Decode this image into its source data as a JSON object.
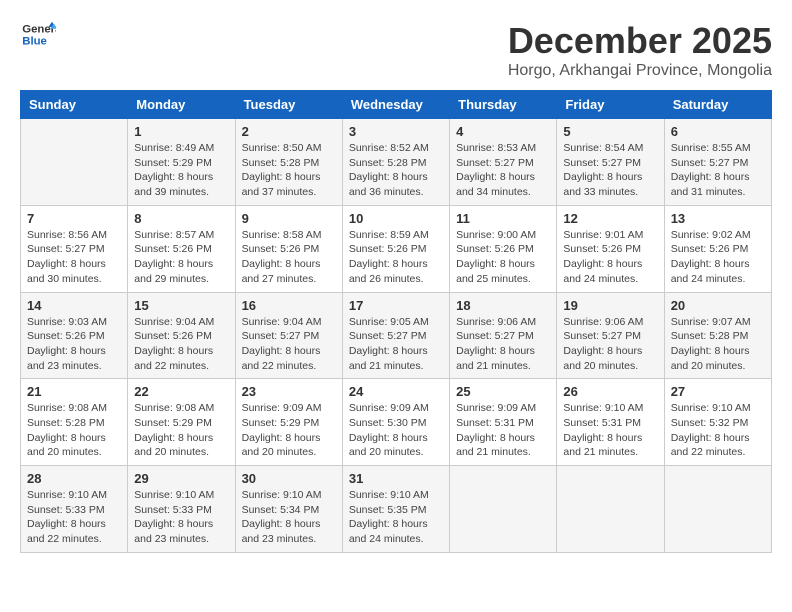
{
  "logo": {
    "line1": "General",
    "line2": "Blue"
  },
  "title": "December 2025",
  "subtitle": "Horgo, Arkhangai Province, Mongolia",
  "days_of_week": [
    "Sunday",
    "Monday",
    "Tuesday",
    "Wednesday",
    "Thursday",
    "Friday",
    "Saturday"
  ],
  "weeks": [
    [
      {
        "day": "",
        "sunrise": "",
        "sunset": "",
        "daylight": ""
      },
      {
        "day": "1",
        "sunrise": "Sunrise: 8:49 AM",
        "sunset": "Sunset: 5:29 PM",
        "daylight": "Daylight: 8 hours and 39 minutes."
      },
      {
        "day": "2",
        "sunrise": "Sunrise: 8:50 AM",
        "sunset": "Sunset: 5:28 PM",
        "daylight": "Daylight: 8 hours and 37 minutes."
      },
      {
        "day": "3",
        "sunrise": "Sunrise: 8:52 AM",
        "sunset": "Sunset: 5:28 PM",
        "daylight": "Daylight: 8 hours and 36 minutes."
      },
      {
        "day": "4",
        "sunrise": "Sunrise: 8:53 AM",
        "sunset": "Sunset: 5:27 PM",
        "daylight": "Daylight: 8 hours and 34 minutes."
      },
      {
        "day": "5",
        "sunrise": "Sunrise: 8:54 AM",
        "sunset": "Sunset: 5:27 PM",
        "daylight": "Daylight: 8 hours and 33 minutes."
      },
      {
        "day": "6",
        "sunrise": "Sunrise: 8:55 AM",
        "sunset": "Sunset: 5:27 PM",
        "daylight": "Daylight: 8 hours and 31 minutes."
      }
    ],
    [
      {
        "day": "7",
        "sunrise": "Sunrise: 8:56 AM",
        "sunset": "Sunset: 5:27 PM",
        "daylight": "Daylight: 8 hours and 30 minutes."
      },
      {
        "day": "8",
        "sunrise": "Sunrise: 8:57 AM",
        "sunset": "Sunset: 5:26 PM",
        "daylight": "Daylight: 8 hours and 29 minutes."
      },
      {
        "day": "9",
        "sunrise": "Sunrise: 8:58 AM",
        "sunset": "Sunset: 5:26 PM",
        "daylight": "Daylight: 8 hours and 27 minutes."
      },
      {
        "day": "10",
        "sunrise": "Sunrise: 8:59 AM",
        "sunset": "Sunset: 5:26 PM",
        "daylight": "Daylight: 8 hours and 26 minutes."
      },
      {
        "day": "11",
        "sunrise": "Sunrise: 9:00 AM",
        "sunset": "Sunset: 5:26 PM",
        "daylight": "Daylight: 8 hours and 25 minutes."
      },
      {
        "day": "12",
        "sunrise": "Sunrise: 9:01 AM",
        "sunset": "Sunset: 5:26 PM",
        "daylight": "Daylight: 8 hours and 24 minutes."
      },
      {
        "day": "13",
        "sunrise": "Sunrise: 9:02 AM",
        "sunset": "Sunset: 5:26 PM",
        "daylight": "Daylight: 8 hours and 24 minutes."
      }
    ],
    [
      {
        "day": "14",
        "sunrise": "Sunrise: 9:03 AM",
        "sunset": "Sunset: 5:26 PM",
        "daylight": "Daylight: 8 hours and 23 minutes."
      },
      {
        "day": "15",
        "sunrise": "Sunrise: 9:04 AM",
        "sunset": "Sunset: 5:26 PM",
        "daylight": "Daylight: 8 hours and 22 minutes."
      },
      {
        "day": "16",
        "sunrise": "Sunrise: 9:04 AM",
        "sunset": "Sunset: 5:27 PM",
        "daylight": "Daylight: 8 hours and 22 minutes."
      },
      {
        "day": "17",
        "sunrise": "Sunrise: 9:05 AM",
        "sunset": "Sunset: 5:27 PM",
        "daylight": "Daylight: 8 hours and 21 minutes."
      },
      {
        "day": "18",
        "sunrise": "Sunrise: 9:06 AM",
        "sunset": "Sunset: 5:27 PM",
        "daylight": "Daylight: 8 hours and 21 minutes."
      },
      {
        "day": "19",
        "sunrise": "Sunrise: 9:06 AM",
        "sunset": "Sunset: 5:27 PM",
        "daylight": "Daylight: 8 hours and 20 minutes."
      },
      {
        "day": "20",
        "sunrise": "Sunrise: 9:07 AM",
        "sunset": "Sunset: 5:28 PM",
        "daylight": "Daylight: 8 hours and 20 minutes."
      }
    ],
    [
      {
        "day": "21",
        "sunrise": "Sunrise: 9:08 AM",
        "sunset": "Sunset: 5:28 PM",
        "daylight": "Daylight: 8 hours and 20 minutes."
      },
      {
        "day": "22",
        "sunrise": "Sunrise: 9:08 AM",
        "sunset": "Sunset: 5:29 PM",
        "daylight": "Daylight: 8 hours and 20 minutes."
      },
      {
        "day": "23",
        "sunrise": "Sunrise: 9:09 AM",
        "sunset": "Sunset: 5:29 PM",
        "daylight": "Daylight: 8 hours and 20 minutes."
      },
      {
        "day": "24",
        "sunrise": "Sunrise: 9:09 AM",
        "sunset": "Sunset: 5:30 PM",
        "daylight": "Daylight: 8 hours and 20 minutes."
      },
      {
        "day": "25",
        "sunrise": "Sunrise: 9:09 AM",
        "sunset": "Sunset: 5:31 PM",
        "daylight": "Daylight: 8 hours and 21 minutes."
      },
      {
        "day": "26",
        "sunrise": "Sunrise: 9:10 AM",
        "sunset": "Sunset: 5:31 PM",
        "daylight": "Daylight: 8 hours and 21 minutes."
      },
      {
        "day": "27",
        "sunrise": "Sunrise: 9:10 AM",
        "sunset": "Sunset: 5:32 PM",
        "daylight": "Daylight: 8 hours and 22 minutes."
      }
    ],
    [
      {
        "day": "28",
        "sunrise": "Sunrise: 9:10 AM",
        "sunset": "Sunset: 5:33 PM",
        "daylight": "Daylight: 8 hours and 22 minutes."
      },
      {
        "day": "29",
        "sunrise": "Sunrise: 9:10 AM",
        "sunset": "Sunset: 5:33 PM",
        "daylight": "Daylight: 8 hours and 23 minutes."
      },
      {
        "day": "30",
        "sunrise": "Sunrise: 9:10 AM",
        "sunset": "Sunset: 5:34 PM",
        "daylight": "Daylight: 8 hours and 23 minutes."
      },
      {
        "day": "31",
        "sunrise": "Sunrise: 9:10 AM",
        "sunset": "Sunset: 5:35 PM",
        "daylight": "Daylight: 8 hours and 24 minutes."
      },
      {
        "day": "",
        "sunrise": "",
        "sunset": "",
        "daylight": ""
      },
      {
        "day": "",
        "sunrise": "",
        "sunset": "",
        "daylight": ""
      },
      {
        "day": "",
        "sunrise": "",
        "sunset": "",
        "daylight": ""
      }
    ]
  ]
}
